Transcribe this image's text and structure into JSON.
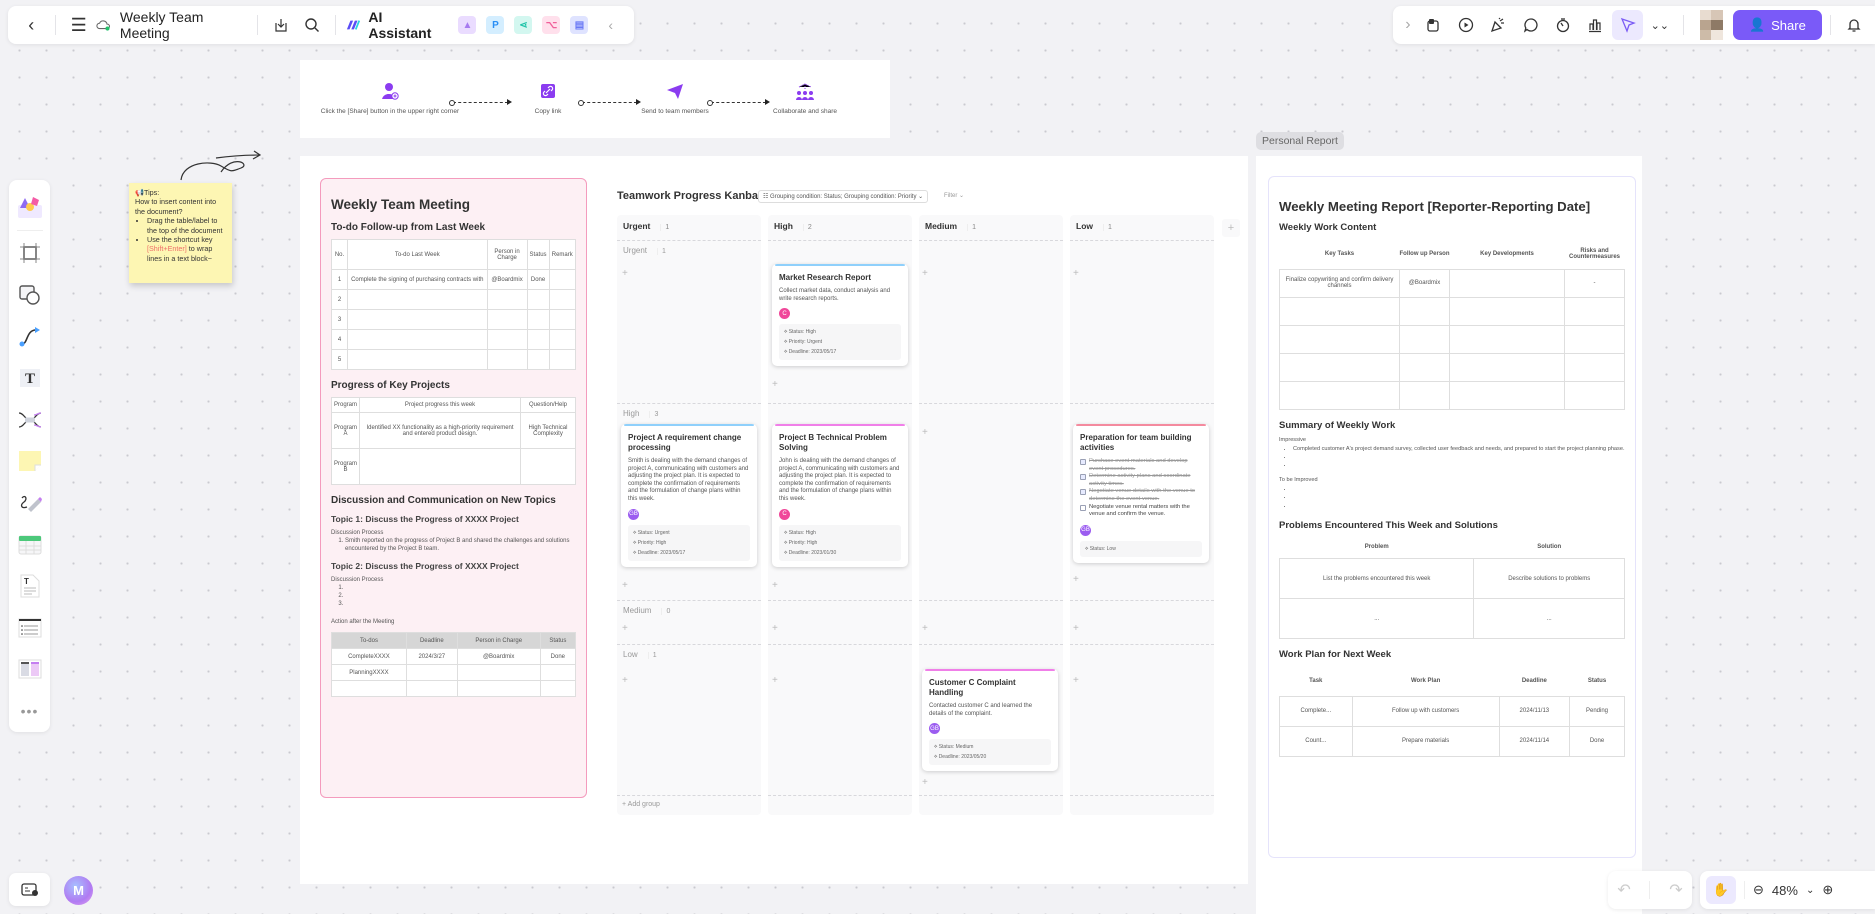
{
  "topbar": {
    "title": "Weekly Team Meeting",
    "ai_assistant_label": "AI Assistant",
    "share_label": "Share",
    "left_icons": [
      "back-icon",
      "menu-icon",
      "cloud-sync-icon",
      "download-icon",
      "search-icon"
    ],
    "app_tiles": [
      {
        "name": "image-gen-tile",
        "glyph": "▲",
        "bg": "#eadcff",
        "fg": "#a77bf0"
      },
      {
        "name": "presentation-tile",
        "glyph": "P",
        "bg": "#d4eeff",
        "fg": "#2a8ff5"
      },
      {
        "name": "mindmap-tile",
        "glyph": "⋖",
        "bg": "#d3f7f0",
        "fg": "#1ec3a8"
      },
      {
        "name": "flowchart-tile",
        "glyph": "⌥",
        "bg": "#ffe0ec",
        "fg": "#f0609a"
      },
      {
        "name": "chat-tile",
        "glyph": "▤",
        "bg": "#dfe3ff",
        "fg": "#6a79f5"
      }
    ],
    "right_icons": [
      "expand-right-icon",
      "template-icon",
      "present-play-icon",
      "celebrate-icon",
      "comment-icon",
      "timer-icon",
      "vote-icon",
      "follow-cursor-icon",
      "more-chevrons-icon"
    ],
    "avatar_colors": [
      "#e8dcd0",
      "#d7c6b6",
      "#b9a48f",
      "#8e7a66",
      "#cdbba8",
      "#efe6dd"
    ]
  },
  "left_toolbar": [
    "templates-tool",
    "frame-tool",
    "shape-tool",
    "connector-tool",
    "text-tool",
    "mindmap-tool",
    "sticky-note-tool",
    "pen-tool",
    "table-tool",
    "document-tool",
    "list-tool",
    "kanban-tool",
    "more-tools"
  ],
  "flow": {
    "steps": [
      {
        "label": "Click the [Share] button in the upper right corner",
        "icon": "add-user-icon"
      },
      {
        "label": "Copy link",
        "icon": "link-icon"
      },
      {
        "label": "Send to team members",
        "icon": "send-icon"
      },
      {
        "label": "Collaborate and share",
        "icon": "team-icon"
      }
    ]
  },
  "sticky": {
    "title": "Tips:",
    "question": "How to insert content into the document?",
    "bullet1": "Drag the table/label to the top of the document",
    "bullet2_pre": "Use the shortcut key ",
    "bullet2_key": "[Shift+Enter]",
    "bullet2_post": " to wrap lines in a text block~"
  },
  "meeting_doc": {
    "title": "Weekly Team Meeting",
    "todo_heading": "To-do Follow-up from Last Week",
    "todo_headers": [
      "No.",
      "To-do Last Week",
      "Person in Charge",
      "Status",
      "Remark"
    ],
    "todo_rows": [
      [
        "1",
        "Complete the signing of purchasing contracts with",
        "@Boardmix",
        "Done",
        ""
      ],
      [
        "2",
        "",
        "",
        "",
        ""
      ],
      [
        "3",
        "",
        "",
        "",
        ""
      ],
      [
        "4",
        "",
        "",
        "",
        ""
      ],
      [
        "5",
        "",
        "",
        "",
        ""
      ]
    ],
    "projects_heading": "Progress of Key Projects",
    "projects_headers": [
      "Program",
      "Project progress this week",
      "Question/Help"
    ],
    "projects_rows": [
      [
        "Program A",
        "Identified XX functionality as a high-priority requirement and entered product design.",
        "High Technical Complexity"
      ],
      [
        "Program B",
        "",
        ""
      ]
    ],
    "discussion_heading": "Discussion and Communication on New Topics",
    "topic1": "Topic 1: Discuss the Progress of XXXX Project",
    "topic1_label": "Discussion Process",
    "topic1_item": "Smith reported on the progress of Project B and shared the challenges and solutions encountered by the Project B team.",
    "topic2": "Topic 2: Discuss the Progress of XXXX Project",
    "topic2_label": "Discussion Process",
    "action_label": "Action after the Meeting",
    "action_headers": [
      "To-dos",
      "Deadline",
      "Person in Charge",
      "Status"
    ],
    "action_rows": [
      [
        "CompleteXXXX",
        "2024/3/27",
        "@Boardmix",
        "Done"
      ],
      [
        "PlanningXXXX",
        "",
        "",
        ""
      ],
      [
        "",
        "",
        "",
        ""
      ]
    ]
  },
  "kanban": {
    "title": "Teamwork Progress Kanban",
    "grouping": "Grouping condition: Status; Grouping condition: Priority",
    "filter": "Filter",
    "add_group": "+ Add group",
    "columns": [
      {
        "label": "Urgent",
        "count": "1"
      },
      {
        "label": "High",
        "count": "2"
      },
      {
        "label": "Medium",
        "count": "1"
      },
      {
        "label": "Low",
        "count": "1"
      }
    ],
    "groups": [
      {
        "label": "Urgent",
        "count": "1"
      },
      {
        "label": "High",
        "count": "3"
      },
      {
        "label": "Medium",
        "count": "0"
      },
      {
        "label": "Low",
        "count": "1"
      }
    ],
    "cards": {
      "market": {
        "title": "Market Research Report",
        "desc": "Collect market data, conduct analysis and write research reports.",
        "avatar": "C",
        "avatar_color": "#f0479a",
        "bar": "#8fd0fb",
        "meta": [
          "Status: High",
          "Priority: Urgent",
          "Deadline: 2023/05/17"
        ]
      },
      "projA": {
        "title": "Project A requirement change processing",
        "desc": "Smith is dealing with the demand changes of project A, communicating with customers and adjusting the project plan. It is expected to complete the confirmation of requirements and the formulation of change plans within this week.",
        "avatar": "GB",
        "avatar_color": "#9b5cf0",
        "bar": "#8fd0fb",
        "meta": [
          "Status: Urgent",
          "Priority: High",
          "Deadline: 2023/05/17"
        ]
      },
      "projB": {
        "title": "Project B Technical Problem Solving",
        "desc": "John is dealing with the demand changes of project A, communicating with customers and adjusting the project plan. It is expected to complete the confirmation of requirements and the formulation of change plans within this week.",
        "avatar": "C",
        "avatar_color": "#f0479a",
        "bar": "#f07fe8",
        "meta": [
          "Status: High",
          "Priority: High",
          "Deadline: 2023/01/30"
        ]
      },
      "team": {
        "title": "Preparation for team building activities",
        "checklist": [
          {
            "text": "Purchase event materials and develop event procedures.",
            "done": true
          },
          {
            "text": "Determine activity plans and coordinate activity times.",
            "done": true
          },
          {
            "text": "Negotiate venue details with the venue to determine the event venue.",
            "done": true
          },
          {
            "text": "Negotiate venue rental matters with the venue and confirm the venue.",
            "done": false
          }
        ],
        "avatar": "GB",
        "avatar_color": "#9b5cf0",
        "bar": "#f48a9e",
        "meta": [
          "Status: Low"
        ]
      },
      "customer": {
        "title": "Customer C Complaint Handling",
        "desc": "Contacted customer C and learned the details of the complaint.",
        "avatar": "GB",
        "avatar_color": "#9b5cf0",
        "bar": "#f07fe8",
        "meta": [
          "Status: Medium",
          "Deadline: 2023/05/20"
        ]
      }
    }
  },
  "personal_report": {
    "tab": "Personal Report",
    "title": "Weekly Meeting Report [Reporter-Reporting Date]",
    "work_heading": "Weekly Work Content",
    "work_headers": [
      "Key Tasks",
      "Follow up Person",
      "Key Developments",
      "Risks and Countermeasures"
    ],
    "work_rows": [
      [
        "Finalize copywriting and confirm delivery channels",
        "@Boardmix",
        "",
        "-"
      ],
      [
        "",
        "",
        "",
        ""
      ],
      [
        "",
        "",
        "",
        ""
      ],
      [
        "",
        "",
        "",
        ""
      ],
      [
        "",
        "",
        "",
        ""
      ]
    ],
    "summary_heading": "Summary of Weekly Work",
    "impressive_label": "Impressive",
    "impressive_item": "Completed customer A's project demand survey, collected user feedback and needs, and prepared to start the project planning phase.",
    "improve_label": "To be Improved",
    "problems_heading": "Problems Encountered This Week and Solutions",
    "problems_headers": [
      "Problem",
      "Solution"
    ],
    "problems_rows": [
      [
        "List the problems encountered this week",
        "Describe solutions to problems"
      ],
      [
        "...",
        "..."
      ]
    ],
    "plan_heading": "Work Plan for Next Week",
    "plan_headers": [
      "Task",
      "Work Plan",
      "Deadline",
      "Status"
    ],
    "plan_rows": [
      [
        "Complete...",
        "Follow up with customers",
        "2024/11/13",
        "Pending"
      ],
      [
        "Count...",
        "Prepare materials",
        "2024/11/14",
        "Done"
      ]
    ]
  },
  "bottom": {
    "zoom_level": "48%",
    "ai_logo": "M"
  }
}
